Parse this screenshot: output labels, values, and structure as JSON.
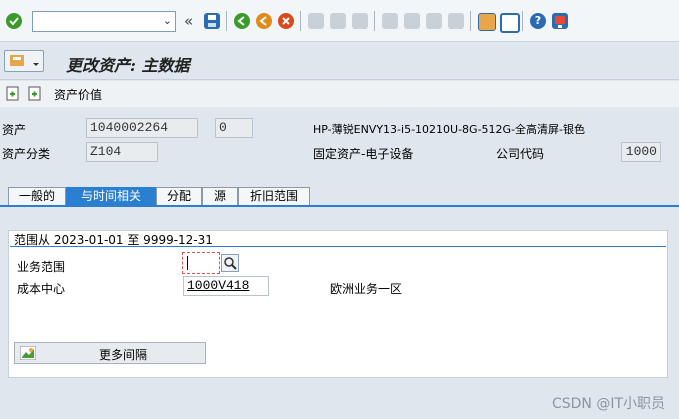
{
  "toolbar": {
    "command_field": {
      "value": "",
      "placeholder": ""
    },
    "icons": [
      "enter-icon",
      "save-icon",
      "back-icon",
      "exit-icon",
      "cancel-icon",
      "print-icon",
      "find-icon",
      "find-next-icon",
      "first-page-icon",
      "previous-page-icon",
      "next-page-icon",
      "last-page-icon",
      "create-session-icon",
      "shortcut-icon",
      "help-icon",
      "customize-layout-icon"
    ],
    "colors": {
      "enter": "#3a9a2a",
      "save": "#2b6cb0",
      "back": "#3a9a2a",
      "exit": "#e08a1a",
      "cancel": "#d94a1a",
      "help": "#2b6cb0"
    }
  },
  "title": "更改资产: 主数据",
  "app_toolbar": {
    "asset_value_label": "资产价值"
  },
  "header": {
    "asset_label": "资产",
    "asset_number": "1040002264",
    "sub_number": "0",
    "asset_description": "HP-薄锐ENVY13-i5-10210U-8G-512G-全高清屏-银色",
    "asset_class_label": "资产分类",
    "asset_class": "Z104",
    "asset_class_description": "固定资产-电子设备",
    "company_code_label": "公司代码",
    "company_code": "1000"
  },
  "tabs": [
    {
      "label": "一般的",
      "active": false
    },
    {
      "label": "与时间相关",
      "active": true
    },
    {
      "label": "分配",
      "active": false
    },
    {
      "label": "源",
      "active": false
    },
    {
      "label": "折旧范围",
      "active": false
    }
  ],
  "time_dependent": {
    "range_label": "范围从 2023-01-01 至 9999-12-31",
    "business_area_label": "业务范围",
    "business_area_value": "",
    "cost_center_label": "成本中心",
    "cost_center_value": "1000V418",
    "cost_center_description": "欧洲业务一区",
    "more_intervals_label": "更多间隔"
  },
  "watermark": "CSDN @IT小职员"
}
